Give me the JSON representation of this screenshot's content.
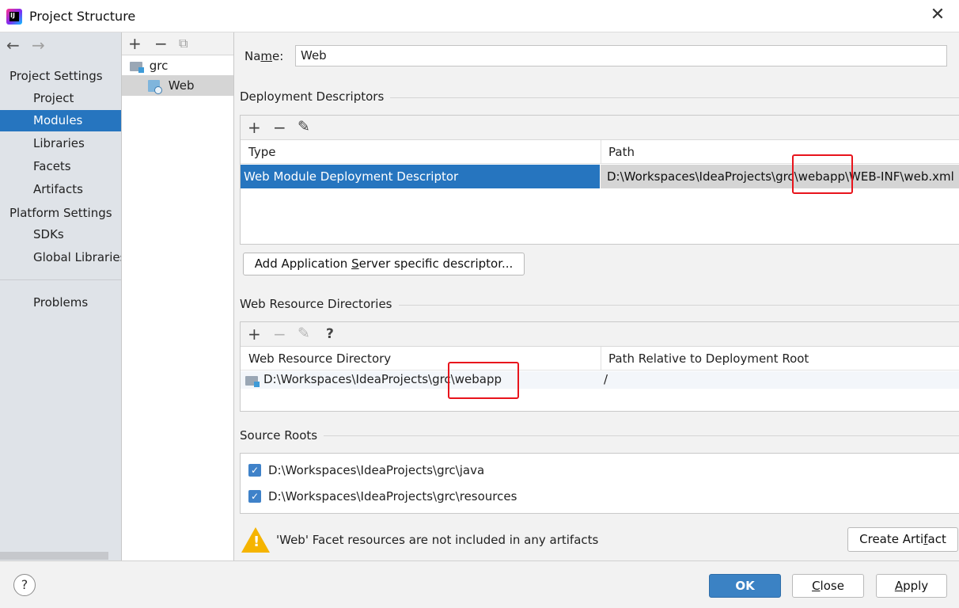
{
  "window": {
    "title": "Project Structure",
    "close_glyph": "✕"
  },
  "nav": {
    "back": "←",
    "forward": "→",
    "project_settings": "Project Settings",
    "items": [
      "Project",
      "Modules",
      "Libraries",
      "Facets",
      "Artifacts"
    ],
    "platform_settings": "Platform Settings",
    "platform_items": [
      "SDKs",
      "Global Libraries"
    ],
    "problems": "Problems",
    "selected": "Modules"
  },
  "tree": {
    "toolbar": {
      "add": "+",
      "remove": "−",
      "copy": "⧉"
    },
    "nodes": [
      {
        "label": "grc",
        "icon": "module-folder-icon"
      },
      {
        "label": "Web",
        "icon": "web-facet-icon"
      }
    ]
  },
  "name_field": {
    "label_pre": "Na",
    "label_underline": "m",
    "label_post": "e:",
    "value": "Web"
  },
  "deployment": {
    "title": "Deployment Descriptors",
    "toolbar": {
      "add": "+",
      "remove": "−",
      "edit": "✎"
    },
    "columns": [
      "Type",
      "Path"
    ],
    "rows": [
      {
        "type": "Web Module Deployment Descriptor",
        "path": "D:\\Workspaces\\IdeaProjects\\grc\\webapp\\WEB-INF\\web.xml"
      }
    ],
    "add_server_button": {
      "pre": "Add Application ",
      "underline": "S",
      "post": "erver specific descriptor..."
    }
  },
  "web_resources": {
    "title": "Web Resource Directories",
    "toolbar": {
      "add": "+",
      "remove": "−",
      "edit": "✎",
      "help": "?"
    },
    "columns": [
      "Web Resource Directory",
      "Path Relative to Deployment Root"
    ],
    "rows": [
      {
        "directory": "D:\\Workspaces\\IdeaProjects\\grc\\webapp",
        "relative": "/"
      }
    ]
  },
  "source_roots": {
    "title": "Source Roots",
    "items": [
      {
        "path": "D:\\Workspaces\\IdeaProjects\\grc\\java",
        "checked": true
      },
      {
        "path": "D:\\Workspaces\\IdeaProjects\\grc\\resources",
        "checked": true
      }
    ]
  },
  "warning": {
    "text": "'Web' Facet resources are not included in any artifacts",
    "icon": "warning-icon"
  },
  "create_artifact": {
    "pre": "Create Arti",
    "underline": "f",
    "post": "act"
  },
  "footer": {
    "help": "?",
    "ok": "OK",
    "close_underline": "C",
    "close_rest": "lose",
    "apply_underline": "A",
    "apply_rest": "pply"
  },
  "colors": {
    "selection": "#2675bf",
    "highlight_box": "#e8141c",
    "primary_button": "#3b82c4"
  }
}
